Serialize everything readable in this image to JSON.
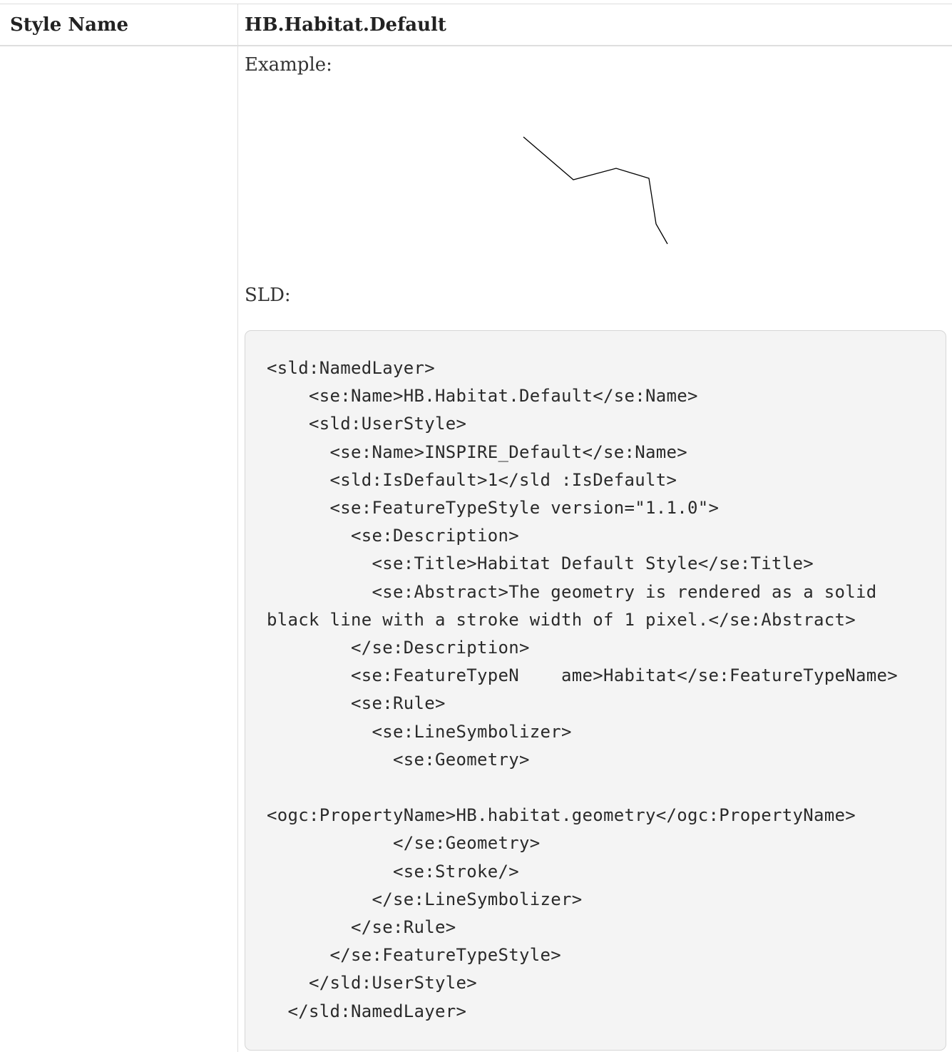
{
  "table": {
    "header": {
      "col1": "Style Name",
      "col2": "HB.Habitat.Default"
    },
    "example_label": "Example:",
    "sld_label": "SLD:",
    "sld_code": "<sld:NamedLayer>\n    <se:Name>HB.Habitat.Default</se:Name>\n    <sld:UserStyle>\n      <se:Name>INSPIRE_Default</se:Name>\n      <sld:IsDefault>1</sld :IsDefault>\n      <se:FeatureTypeStyle version=\"1.1.0\">\n        <se:Description>\n          <se:Title>Habitat Default Style</se:Title>\n          <se:Abstract>The geometry is rendered as a solid\nblack line with a stroke width of 1 pixel.</se:Abstract>\n        </se:Description>\n        <se:FeatureTypeN    ame>Habitat</se:FeatureTypeName>\n        <se:Rule>\n          <se:LineSymbolizer>\n            <se:Geometry>\n\n<ogc:PropertyName>HB.habitat.geometry</ogc:PropertyName>\n            </se:Geometry>\n            <se:Stroke/>\n          </se:LineSymbolizer>\n        </se:Rule>\n      </se:FeatureTypeStyle>\n    </sld:UserStyle>\n  </sld:NamedLayer>"
  },
  "example_image": {
    "stroke_color": "#000000"
  }
}
